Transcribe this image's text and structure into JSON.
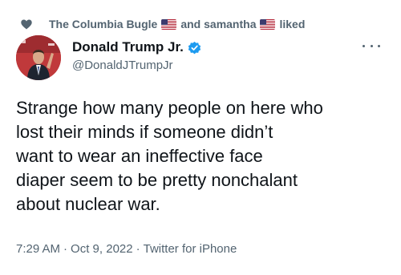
{
  "social_context": {
    "first_liker": "The Columbia Bugle",
    "connector": "and samantha",
    "suffix": "liked",
    "icon": "heart-icon",
    "flag_icon": "us-flag-icon"
  },
  "author": {
    "display_name": "Donald Trump Jr.",
    "handle": "@DonaldJTrumpJr",
    "verified_icon": "verified-badge-icon",
    "verified_color": "#1d9bf0"
  },
  "tweet": {
    "text": "Strange how many people on here who\nlost their minds if someone didn’t\nwant to wear an ineffective face\ndiaper seem to be pretty nonchalant\nabout nuclear war."
  },
  "meta": {
    "time": "7:29 AM",
    "date": "Oct 9, 2022",
    "source": "Twitter for iPhone",
    "separator": "·"
  },
  "colors": {
    "text_primary": "#0f1419",
    "text_secondary": "#536471",
    "accent": "#1d9bf0"
  }
}
